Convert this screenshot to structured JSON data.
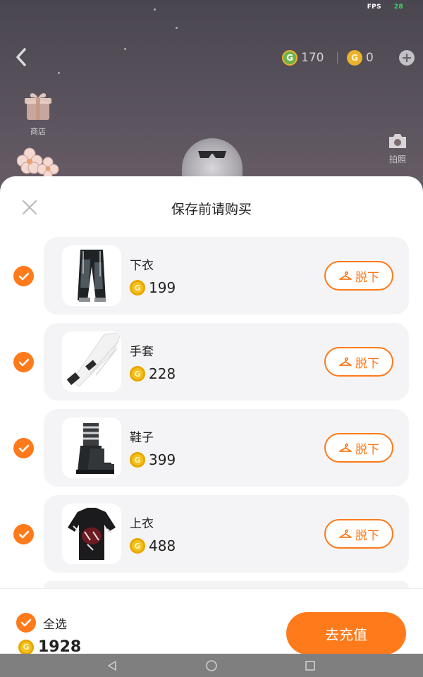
{
  "hud": {
    "fps_label": "FPS",
    "fps_value": "28",
    "currency_green": "170",
    "currency_gold": "0",
    "gift_label": "商店",
    "camera_label": "拍照"
  },
  "sheet": {
    "title": "保存前请购买",
    "remove_label": "脱下",
    "items": [
      {
        "name": "下衣",
        "price": "199"
      },
      {
        "name": "手套",
        "price": "228"
      },
      {
        "name": "鞋子",
        "price": "399"
      },
      {
        "name": "上衣",
        "price": "488"
      }
    ]
  },
  "footer": {
    "select_all_label": "全选",
    "total": "1928",
    "recharge_label": "去充值"
  },
  "colors": {
    "accent": "#ff7a1a",
    "coin": "#f4c01e",
    "card_bg": "#f4f4f6"
  }
}
